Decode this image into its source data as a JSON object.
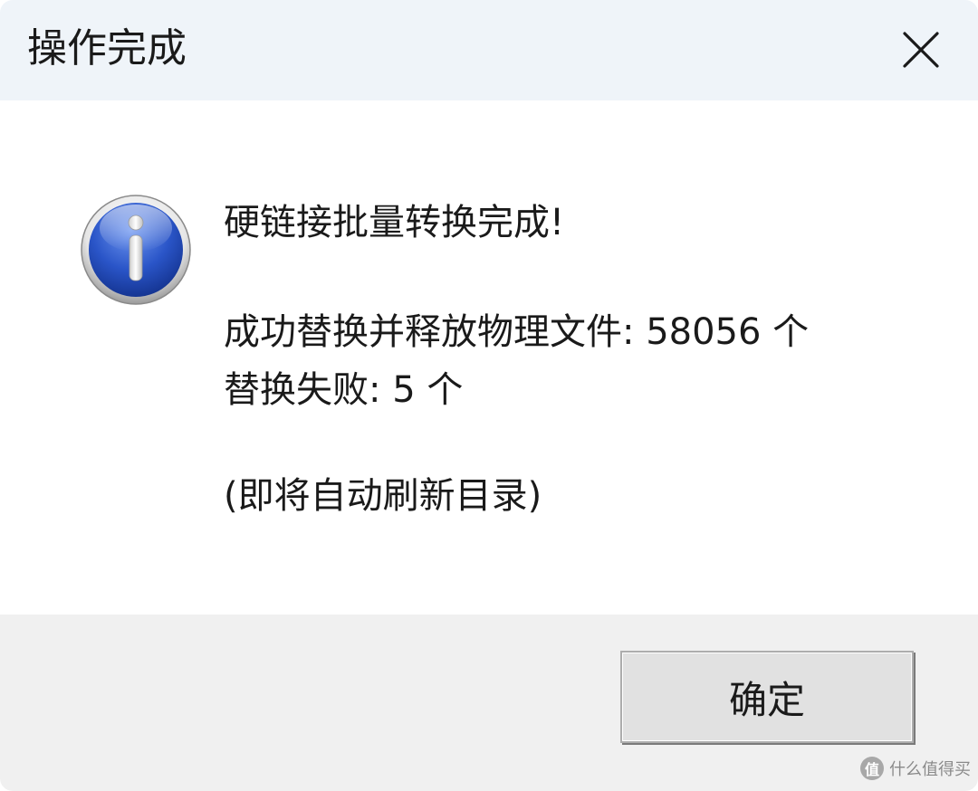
{
  "dialog": {
    "title": "操作完成",
    "icon": "info-icon",
    "message": {
      "line1": "硬链接批量转换完成!",
      "line2": "成功替换并释放物理文件: 58056 个",
      "line3": "替换失败: 5 个",
      "line4": "(即将自动刷新目录)"
    },
    "ok_label": "确定"
  },
  "watermark": {
    "badge": "值",
    "text": "什么值得买"
  },
  "colors": {
    "titlebar": "#eff4f9",
    "footer": "#f0f0f0",
    "button": "#e1e1e1",
    "icon_blue": "#1f47b8"
  }
}
